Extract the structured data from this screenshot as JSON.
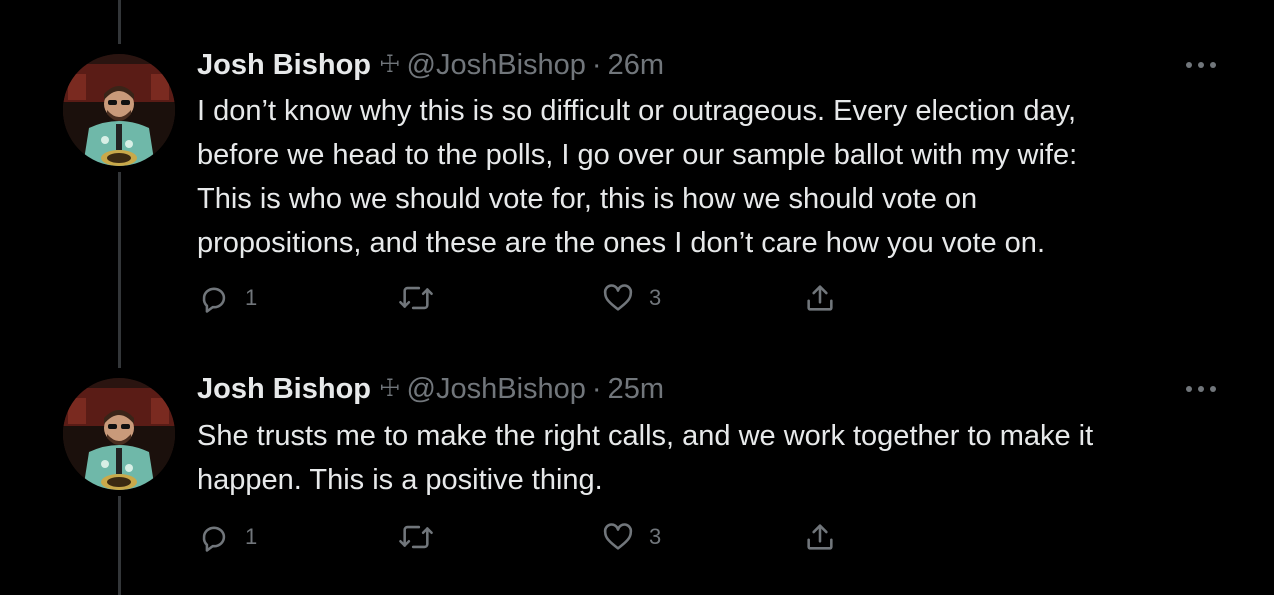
{
  "colors": {
    "background": "#000000",
    "text_primary": "#e7e9ea",
    "text_secondary": "#71767b",
    "thread_line": "#333639"
  },
  "tweets": [
    {
      "author_name": "Josh Bishop",
      "badge_glyph": "☩",
      "handle": "@JoshBishop",
      "separator": "·",
      "time": "26m",
      "text": "I don’t know why this is so difficult or outrageous. Every election day,\nbefore we head to the polls, I go over our sample ballot with my wife:\nThis is who we should vote for, this is how we should vote on\npropositions, and these are the ones I don’t care how you vote on.",
      "replies": "1",
      "retweets": "",
      "likes": "3"
    },
    {
      "author_name": "Josh Bishop",
      "badge_glyph": "☩",
      "handle": "@JoshBishop",
      "separator": "·",
      "time": "25m",
      "text": "She trusts me to make the right calls, and we work together to make it\nhappen. This is a positive thing.",
      "replies": "1",
      "retweets": "",
      "likes": "3"
    }
  ],
  "icons": {
    "reply": "reply-icon",
    "retweet": "retweet-icon",
    "like": "heart-icon",
    "share": "share-icon",
    "more": "more-options-icon"
  }
}
